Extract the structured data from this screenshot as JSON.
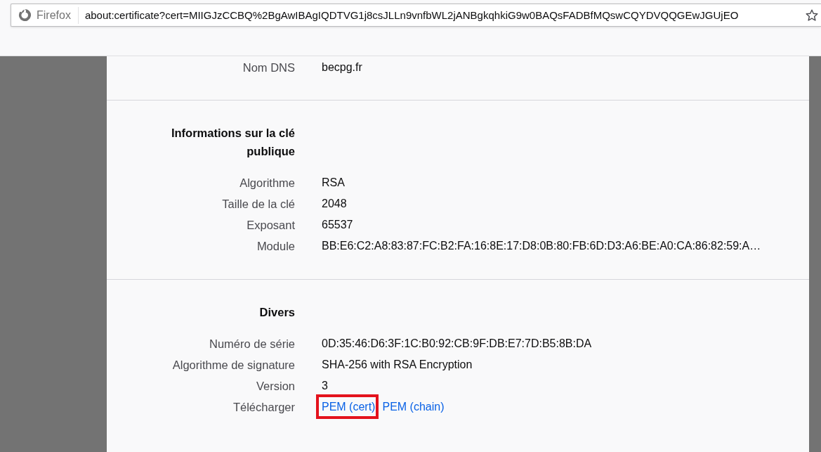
{
  "browser": {
    "identity_label": "Firefox",
    "url": "about:certificate?cert=MIIGJzCCBQ%2BgAwIBAgIQDTVG1j8csJLLn9vnfbWL2jANBgkqhkiG9w0BAQsFADBfMQswCQYDVQQGEwJGUjEO"
  },
  "sections": [
    {
      "rows": [
        {
          "label": "Nom DNS",
          "value": "becpg.fr"
        }
      ]
    },
    {
      "heading": "Informations sur la clé publique",
      "rows": [
        {
          "label": "Algorithme",
          "value": "RSA"
        },
        {
          "label": "Taille de la clé",
          "value": "2048"
        },
        {
          "label": "Exposant",
          "value": "65537"
        },
        {
          "label": "Module",
          "value": "BB:E6:C2:A8:83:87:FC:B2:FA:16:8E:17:D8:0B:80:FB:6D:D3:A6:BE:A0:CA:86:82:59:A…"
        }
      ]
    },
    {
      "heading": "Divers",
      "rows": [
        {
          "label": "Numéro de série",
          "value": "0D:35:46:D6:3F:1C:B0:92:CB:9F:DB:E7:7D:B5:8B:DA"
        },
        {
          "label": "Algorithme de signature",
          "value": "SHA-256 with RSA Encryption"
        },
        {
          "label": "Version",
          "value": "3"
        },
        {
          "label": "Télécharger",
          "links": [
            {
              "text": "PEM (cert)",
              "highlighted": true
            },
            {
              "text": "PEM (chain)",
              "highlighted": false
            }
          ]
        }
      ]
    }
  ]
}
